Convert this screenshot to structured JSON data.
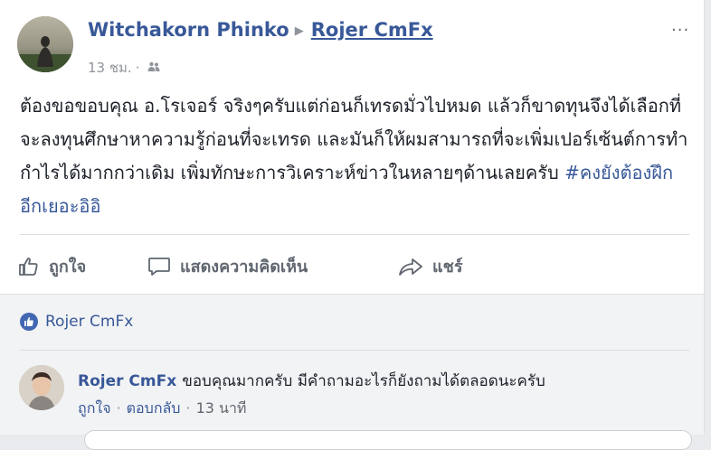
{
  "post": {
    "author": "Witchakorn Phinko",
    "arrow": "▶",
    "page": "Rojer CmFx",
    "time": "13 ชม.",
    "audience_icon": "friends-icon",
    "more": "···",
    "text": "ต้องขอขอบคุณ อ.โรเจอร์ จริงๆครับแต่ก่อนก็เทรดมั่วไปหมด แล้วก็ขาดทุนจึงได้เลือกที่จะลงทุนศึกษาหาความรู้ก่อนที่จะเทรด และมันก็ให้ผมสามารถที่จะเพิ่มเปอร์เซ้นต์การทำกำไรได้มากกว่าเดิม เพิ่มทักษะการวิเคราะห์ข่าวในหลายๆด้านเลยครับ ",
    "hashtag": "#คงยังต้องฝึกอีกเยอะอิอิ"
  },
  "actions": {
    "like": "ถูกใจ",
    "comment": "แสดงความคิดเห็น",
    "share": "แชร์"
  },
  "reactions": {
    "likers": "Rojer CmFx"
  },
  "comment": {
    "author": "Rojer CmFx",
    "text": "ขอบคุณมากครับ มีคำถามอะไรก็ยังถามได้ตลอดนะครับ",
    "like": "ถูกใจ",
    "reply": "ตอบกลับ",
    "time": "13 นาที",
    "separator": "·"
  },
  "colors": {
    "link": "#385898",
    "muted": "#90949c",
    "like_blue": "#4267b2"
  }
}
